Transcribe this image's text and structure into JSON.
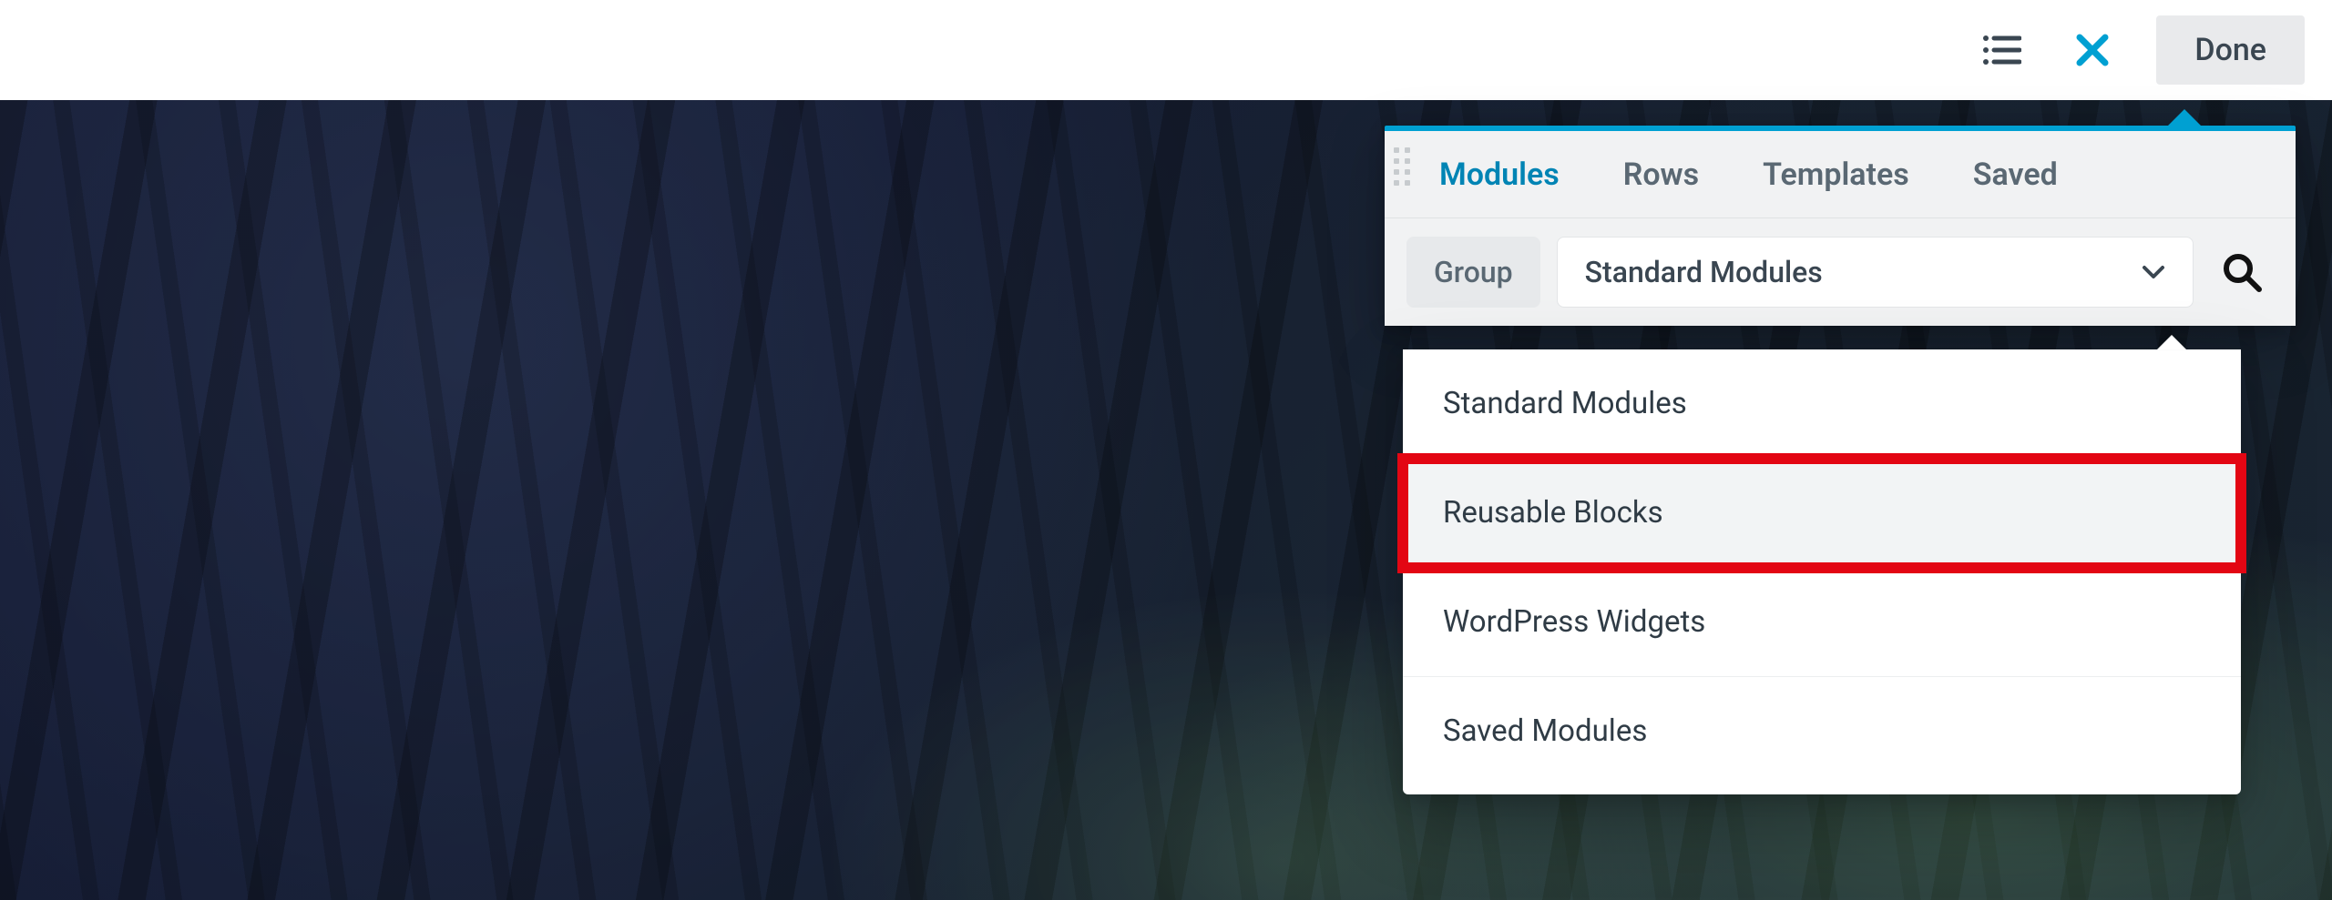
{
  "toolbar": {
    "done_label": "Done"
  },
  "panel": {
    "tabs": [
      {
        "label": "Modules",
        "active": true
      },
      {
        "label": "Rows"
      },
      {
        "label": "Templates"
      },
      {
        "label": "Saved"
      }
    ],
    "group_chip": "Group",
    "group_select_value": "Standard Modules",
    "dropdown": {
      "items": [
        {
          "label": "Standard Modules"
        },
        {
          "label": "Reusable Blocks",
          "highlight": true
        },
        {
          "label": "WordPress Widgets"
        },
        {
          "label": "Saved Modules"
        }
      ]
    }
  },
  "colors": {
    "accent": "#00a0d2",
    "highlight_border": "#e30613"
  }
}
